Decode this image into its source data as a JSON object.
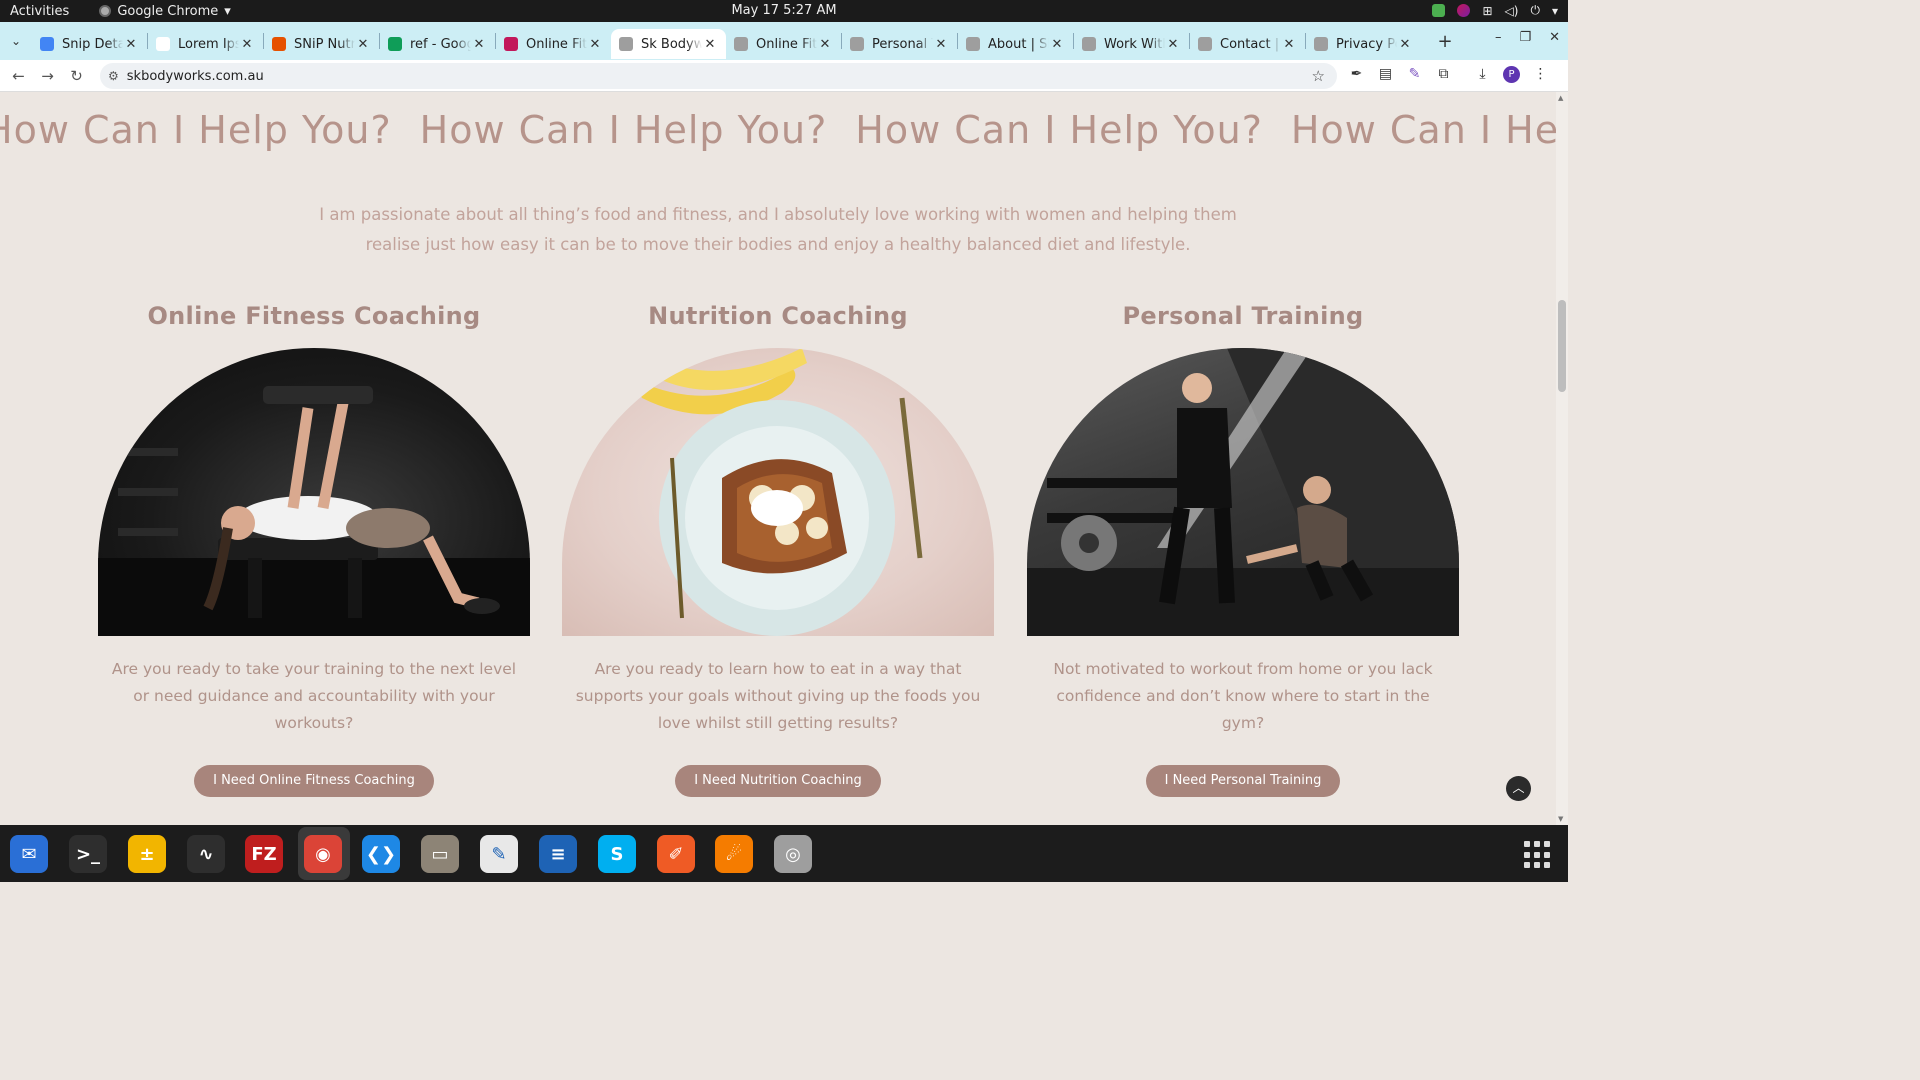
{
  "system": {
    "activities": "Activities",
    "app_name": "Google Chrome",
    "clock": "May 17  5:27 AM"
  },
  "tabs": [
    {
      "title": "Snip Detai",
      "favicon_color": "#4285f4",
      "active": false
    },
    {
      "title": "Lorem Ipsu",
      "favicon_color": "#ffffff",
      "active": false
    },
    {
      "title": "SNiP Nutri",
      "favicon_color": "#e65100",
      "active": false
    },
    {
      "title": "ref - Googl",
      "favicon_color": "#0f9d58",
      "active": false
    },
    {
      "title": "Online Fitr",
      "favicon_color": "#c2185b",
      "active": false
    },
    {
      "title": "Sk Bodywo",
      "favicon_color": "#9e9e9e",
      "active": true
    },
    {
      "title": "Online Fitr",
      "favicon_color": "#9e9e9e",
      "active": false
    },
    {
      "title": "Personal T",
      "favicon_color": "#9e9e9e",
      "active": false
    },
    {
      "title": "About | Sk",
      "favicon_color": "#9e9e9e",
      "active": false
    },
    {
      "title": "Work With",
      "favicon_color": "#9e9e9e",
      "active": false
    },
    {
      "title": "Contact | S",
      "favicon_color": "#9e9e9e",
      "active": false
    },
    {
      "title": "Privacy Po",
      "favicon_color": "#9e9e9e",
      "active": false
    }
  ],
  "omnibox": {
    "url": "skbodyworks.com.au"
  },
  "page": {
    "marquee_text": "How Can I Help You?",
    "intro": "I am passionate about all thing’s food and fitness, and I absolutely love working with women and helping them realise just how easy it can be to move their bodies and enjoy a healthy balanced diet and lifestyle.",
    "services": [
      {
        "title": "Online Fitness Coaching",
        "description": "Are you ready to take your training to the next level or need guidance and accountability with your workouts?",
        "button": "I Need Online Fitness Coaching"
      },
      {
        "title": "Nutrition Coaching",
        "description": "Are you ready to learn how to eat in a way that supports your goals without giving up the foods you love whilst still getting results?",
        "button": "I Need Nutrition Coaching"
      },
      {
        "title": "Personal Training",
        "description": "Not motivated to workout from home or you lack confidence and don’t know where to start in the gym?",
        "button": "I Need Personal Training"
      }
    ]
  },
  "dock": [
    {
      "name": "thunderbird",
      "color": "#2a6fd6",
      "glyph": "✉"
    },
    {
      "name": "terminal",
      "color": "#2e2e2e",
      "glyph": ">_"
    },
    {
      "name": "calculator",
      "color": "#f2b500",
      "glyph": "±"
    },
    {
      "name": "system-monitor",
      "color": "#2e2e2e",
      "glyph": "∿"
    },
    {
      "name": "filezilla",
      "color": "#bf1e1e",
      "glyph": "FZ"
    },
    {
      "name": "chrome",
      "color": "#db4437",
      "glyph": "◉"
    },
    {
      "name": "vscode",
      "color": "#1e88e5",
      "glyph": "❮❯"
    },
    {
      "name": "files",
      "color": "#8d8476",
      "glyph": "▭"
    },
    {
      "name": "text-editor",
      "color": "#e8e8e8",
      "glyph": "✎"
    },
    {
      "name": "libreoffice-writer",
      "color": "#1e63b5",
      "glyph": "≡"
    },
    {
      "name": "skype",
      "color": "#00aff0",
      "glyph": "S"
    },
    {
      "name": "postman",
      "color": "#ef5b25",
      "glyph": "✐"
    },
    {
      "name": "hotshots",
      "color": "#f57c00",
      "glyph": "☄"
    },
    {
      "name": "disks",
      "color": "#9e9e9e",
      "glyph": "◎"
    }
  ]
}
